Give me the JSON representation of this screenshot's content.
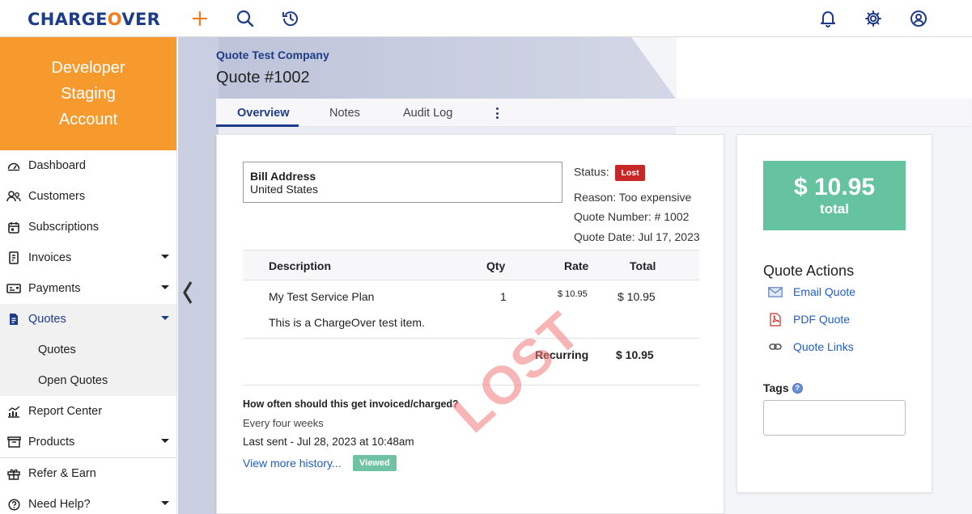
{
  "brand": {
    "logo_pre": "CHARGE",
    "logo_o": "O",
    "logo_post": "VER"
  },
  "sidebar": {
    "account_lines": [
      "Developer",
      "Staging",
      "Account"
    ],
    "items": [
      {
        "label": "Dashboard",
        "icon": "dashboard-gauge-icon"
      },
      {
        "label": "Customers",
        "icon": "customers-icon"
      },
      {
        "label": "Subscriptions",
        "icon": "calendar-icon"
      },
      {
        "label": "Invoices",
        "icon": "invoice-icon"
      },
      {
        "label": "Payments",
        "icon": "payment-card-icon"
      },
      {
        "label": "Quotes",
        "icon": "quote-document-icon"
      },
      {
        "label": "Quotes"
      },
      {
        "label": "Open Quotes"
      },
      {
        "label": "Report Center",
        "icon": "chart-icon"
      },
      {
        "label": "Products",
        "icon": "product-box-icon"
      },
      {
        "label": "Refer & Earn",
        "icon": "gift-icon"
      },
      {
        "label": "Need Help?",
        "icon": "help-circle-icon"
      }
    ]
  },
  "header": {
    "company": "Quote Test Company",
    "title": "Quote #1002"
  },
  "tabs": [
    "Overview",
    "Notes",
    "Audit Log"
  ],
  "quote": {
    "bill_address_heading": "Bill Address",
    "bill_address_country": "United States",
    "status_label": "Status:",
    "status_value": "Lost",
    "reason": "Reason: Too expensive",
    "number": "Quote Number: # 1002",
    "date": "Quote Date: Jul 17, 2023",
    "columns": [
      "Description",
      "Qty",
      "Rate",
      "Total"
    ],
    "line": {
      "description": "My Test Service Plan",
      "note": "This is a ChargeOver test item.",
      "qty": "1",
      "rate": "$ 10.95",
      "total": "$ 10.95"
    },
    "recurring_label": "Recurring",
    "recurring_total": "$ 10.95",
    "stamp": "LOST",
    "history_question": "How often should this get invoiced/charged?",
    "history_frequency": "Every four weeks",
    "last_sent": "Last sent - Jul 28, 2023 at 10:48am",
    "history_link": "View more history...",
    "viewed_badge": "Viewed"
  },
  "side": {
    "total_amount": "$ 10.95",
    "total_label": "total",
    "actions_title": "Quote Actions",
    "actions": [
      {
        "label": "Email Quote",
        "icon": "envelope-icon"
      },
      {
        "label": "PDF Quote",
        "icon": "pdf-icon"
      },
      {
        "label": "Quote Links",
        "icon": "link-icon"
      }
    ],
    "tags_label": "Tags",
    "tags_value": ""
  },
  "colors": {
    "brand_blue": "#1f3c88",
    "brand_orange": "#f47c20",
    "account_orange": "#f79a2e",
    "lost_red": "#c62828",
    "total_green": "#66c3a0"
  }
}
